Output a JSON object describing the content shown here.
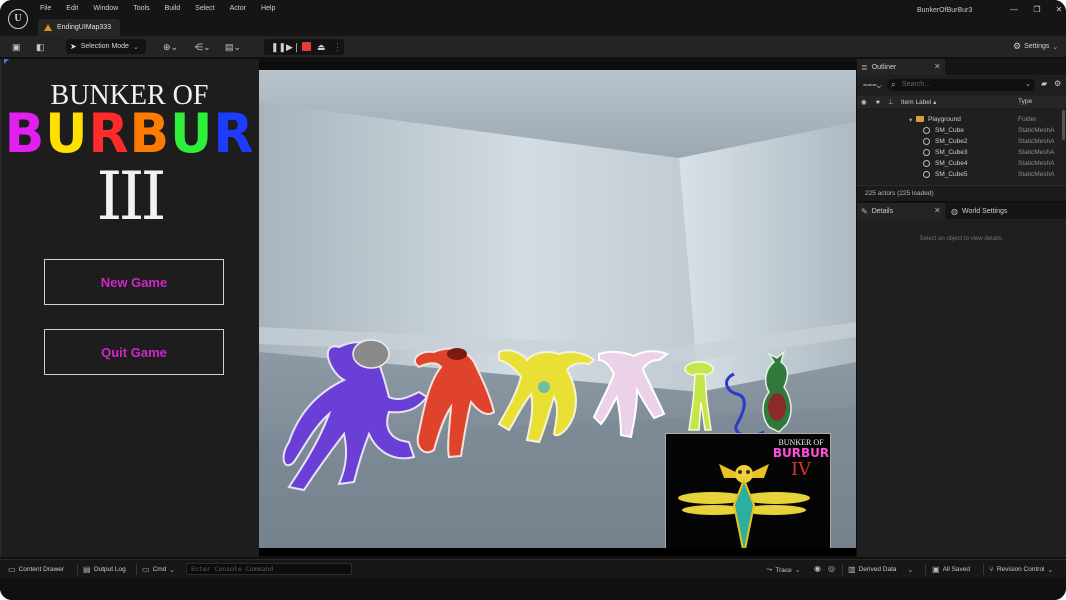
{
  "window": {
    "project_name": "BunkerOfBurBur3",
    "level_tab": "EndingUIMap333"
  },
  "menu": [
    "File",
    "Edit",
    "Window",
    "Tools",
    "Build",
    "Select",
    "Actor",
    "Help"
  ],
  "toolbar": {
    "selection_mode": "Selection Mode",
    "settings": "Settings"
  },
  "game_menu": {
    "logo_line1": "BUNKER OF",
    "logo_line2_letters": [
      "B",
      "U",
      "R",
      "B",
      "U",
      "R"
    ],
    "logo_line3": "III",
    "new_game": "New Game",
    "quit_game": "Quit Game"
  },
  "preview": {
    "line1": "BUNKER OF",
    "line2": "BURBUR",
    "line3": "IV"
  },
  "outliner": {
    "tab": "Outliner",
    "search_placeholder": "Search...",
    "col_label": "Item Label ▴",
    "col_type": "Type",
    "rows": [
      {
        "name": "Playground",
        "type": "Folder",
        "kind": "folder"
      },
      {
        "name": "SM_Cube",
        "type": "StaticMeshA",
        "kind": "mesh"
      },
      {
        "name": "SM_Cube2",
        "type": "StaticMeshA",
        "kind": "mesh"
      },
      {
        "name": "SM_Cube3",
        "type": "StaticMeshA",
        "kind": "mesh"
      },
      {
        "name": "SM_Cube4",
        "type": "StaticMeshA",
        "kind": "mesh"
      },
      {
        "name": "SM_Cube5",
        "type": "StaticMeshA",
        "kind": "mesh"
      }
    ],
    "actor_count": "225 actors (225 loaded)"
  },
  "details": {
    "tab": "Details",
    "world_tab": "World Settings",
    "hint": "Select an object to view details."
  },
  "statusbar": {
    "content_drawer": "Content Drawer",
    "output_log": "Output Log",
    "cmd": "Cmd",
    "console_placeholder": "Enter Console Command",
    "trace": "Trace",
    "derived_data": "Derived Data",
    "all_saved": "All Saved",
    "revision_control": "Revision Control"
  },
  "colors": {
    "logo_B": "#e01ff0",
    "logo_U": "#ffe000",
    "logo_R": "#ff2b2b",
    "logo_B2": "#ff7a00",
    "logo_U2": "#2ef03a",
    "logo_R2": "#1e3cff",
    "button_text": "#d026c8",
    "stop": "#e23d3d",
    "folder": "#d4a23c"
  }
}
